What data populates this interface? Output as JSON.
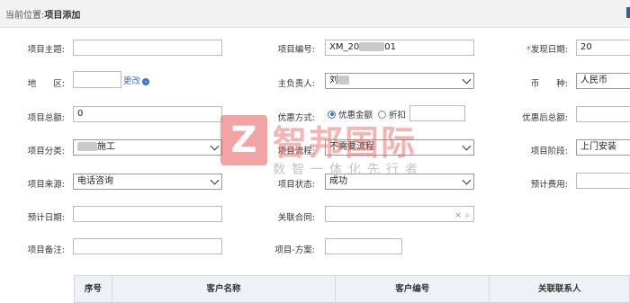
{
  "breadcrumb": {
    "prefix": "当前位置:",
    "page": "项目添加"
  },
  "labels": {
    "subject": "项目主题:",
    "number": "项目编号:",
    "found_date": "发现日期:",
    "region": "地　　区:",
    "owner": "主负责人:",
    "currency": "币　　种:",
    "total": "项目总额:",
    "discount_mode": "优惠方式:",
    "after_discount": "优惠后总额:",
    "category": "项目分类:",
    "process": "项目流程:",
    "stage": "项目阶段:",
    "source": "项目来源:",
    "status": "项目状态:",
    "est_cost": "预计费用:",
    "est_date": "预计日期:",
    "contract": "关联合同:",
    "remark": "项目备注:",
    "plan": "项目-方案:"
  },
  "values": {
    "subject": "",
    "number": "XM_20",
    "number_suffix": "01",
    "found_date": "20",
    "region": "",
    "owner": "刘",
    "currency": "人民币",
    "total": "0",
    "discount_amount": "",
    "after_discount": "",
    "category": "施工",
    "process": "不需要流程",
    "stage": "上门安装",
    "source": "电话咨询",
    "status": "成功",
    "est_cost": "",
    "est_date": "",
    "contract": "",
    "remark": "",
    "plan": ""
  },
  "region_change_link": "更改",
  "discount_options": {
    "amount": "优惠金额",
    "rate": "折扣"
  },
  "contract_icons": {
    "clear": "×",
    "search": "⌕"
  },
  "table_headers": [
    "序号",
    "客户名称",
    "客户编号",
    "关联联系人"
  ],
  "watermark": {
    "logo": "Z",
    "title": "智邦国际",
    "slogan": "数智一体化先行者"
  }
}
